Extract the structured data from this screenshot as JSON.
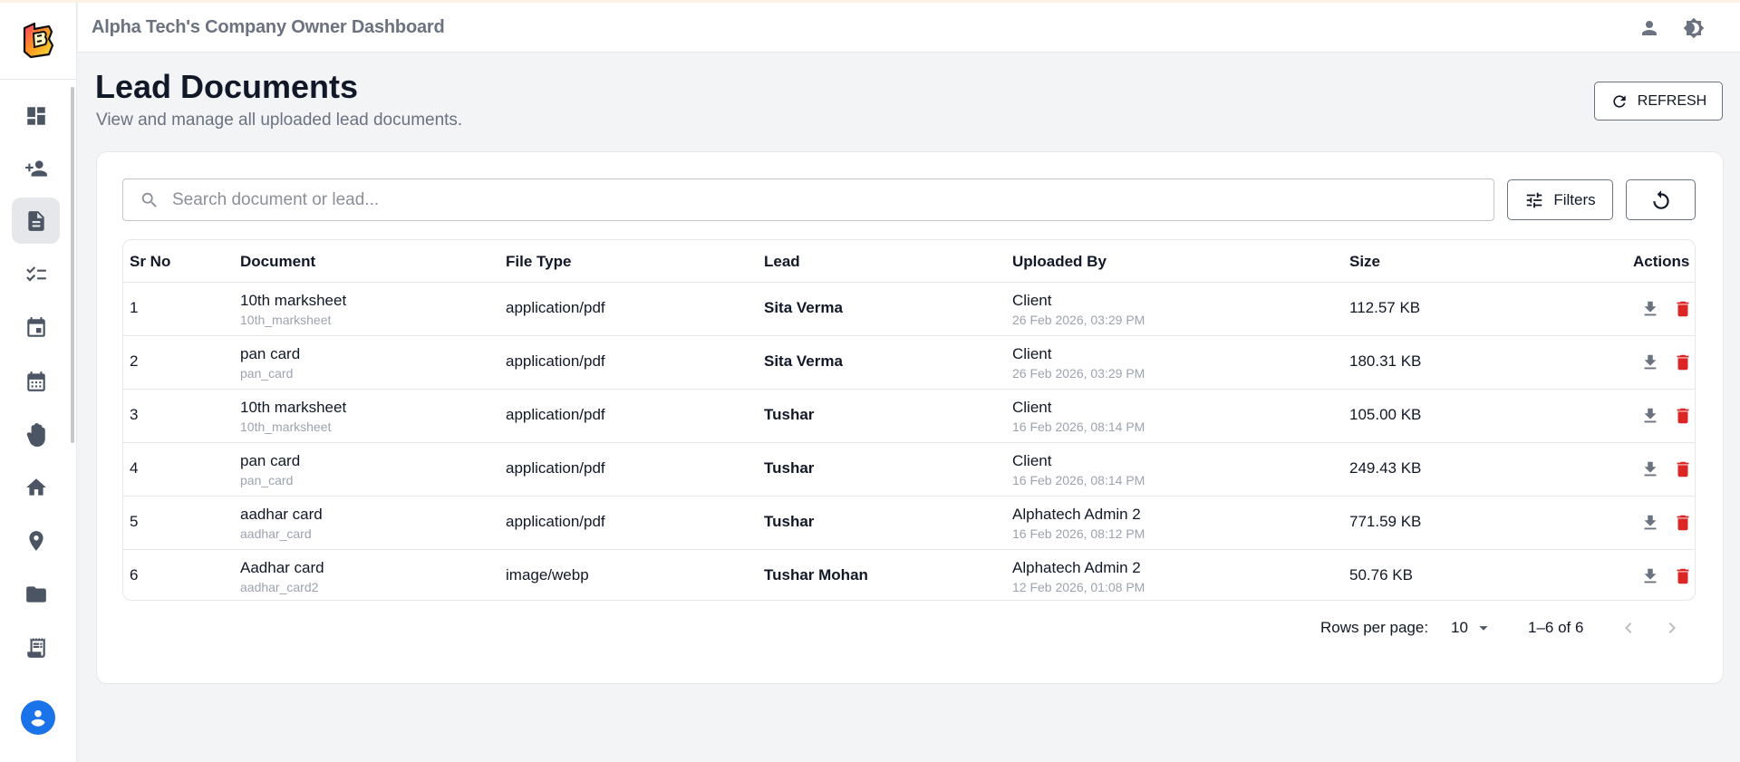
{
  "header": {
    "title": "Alpha Tech's Company Owner Dashboard",
    "profile_icon": "person-icon",
    "theme_icon": "brightness-icon"
  },
  "sidebar": {
    "items": [
      {
        "name": "dashboard",
        "icon": "dashboard-icon",
        "active": false
      },
      {
        "name": "add-user",
        "icon": "person-add-icon",
        "active": false
      },
      {
        "name": "documents",
        "icon": "document-icon",
        "active": true
      },
      {
        "name": "checklist",
        "icon": "checklist-icon",
        "active": false
      },
      {
        "name": "event",
        "icon": "event-icon",
        "active": false
      },
      {
        "name": "calendar",
        "icon": "calendar-icon",
        "active": false
      },
      {
        "name": "hand",
        "icon": "hand-icon",
        "active": false
      },
      {
        "name": "home",
        "icon": "home-icon",
        "active": false
      },
      {
        "name": "location",
        "icon": "location-pin-icon",
        "active": false
      },
      {
        "name": "folder",
        "icon": "folder-icon",
        "active": false
      },
      {
        "name": "receipt",
        "icon": "receipt-icon",
        "active": false
      }
    ]
  },
  "page": {
    "title": "Lead Documents",
    "subtitle": "View and manage all uploaded lead documents.",
    "refresh_label": "REFRESH"
  },
  "toolbar": {
    "search_placeholder": "Search document or lead...",
    "search_value": "",
    "filters_label": "Filters"
  },
  "table": {
    "columns": [
      "Sr No",
      "Document",
      "File Type",
      "Lead",
      "Uploaded By",
      "Size",
      "Actions"
    ],
    "rows": [
      {
        "sr": "1",
        "doc": "10th marksheet",
        "doc_key": "10th_marksheet",
        "type": "application/pdf",
        "lead": "Sita Verma",
        "by": "Client",
        "date": "26 Feb 2026, 03:29 PM",
        "size": "112.57 KB"
      },
      {
        "sr": "2",
        "doc": "pan card",
        "doc_key": "pan_card",
        "type": "application/pdf",
        "lead": "Sita Verma",
        "by": "Client",
        "date": "26 Feb 2026, 03:29 PM",
        "size": "180.31 KB"
      },
      {
        "sr": "3",
        "doc": "10th marksheet",
        "doc_key": "10th_marksheet",
        "type": "application/pdf",
        "lead": "Tushar",
        "by": "Client",
        "date": "16 Feb 2026, 08:14 PM",
        "size": "105.00 KB"
      },
      {
        "sr": "4",
        "doc": "pan card",
        "doc_key": "pan_card",
        "type": "application/pdf",
        "lead": "Tushar",
        "by": "Client",
        "date": "16 Feb 2026, 08:14 PM",
        "size": "249.43 KB"
      },
      {
        "sr": "5",
        "doc": "aadhar card",
        "doc_key": "aadhar_card",
        "type": "application/pdf",
        "lead": "Tushar",
        "by": "Alphatech Admin 2",
        "date": "16 Feb 2026, 08:12 PM",
        "size": "771.59 KB"
      },
      {
        "sr": "6",
        "doc": "Aadhar card",
        "doc_key": "aadhar_card2",
        "type": "image/webp",
        "lead": "Tushar Mohan",
        "by": "Alphatech Admin 2",
        "date": "12 Feb 2026, 01:08 PM",
        "size": "50.76 KB"
      }
    ]
  },
  "pagination": {
    "rows_label": "Rows per page:",
    "rows_value": "10",
    "range": "1–6 of 6"
  },
  "colors": {
    "accent": "#1a73e8",
    "delete": "#dc2626",
    "muted": "#6b7280"
  }
}
